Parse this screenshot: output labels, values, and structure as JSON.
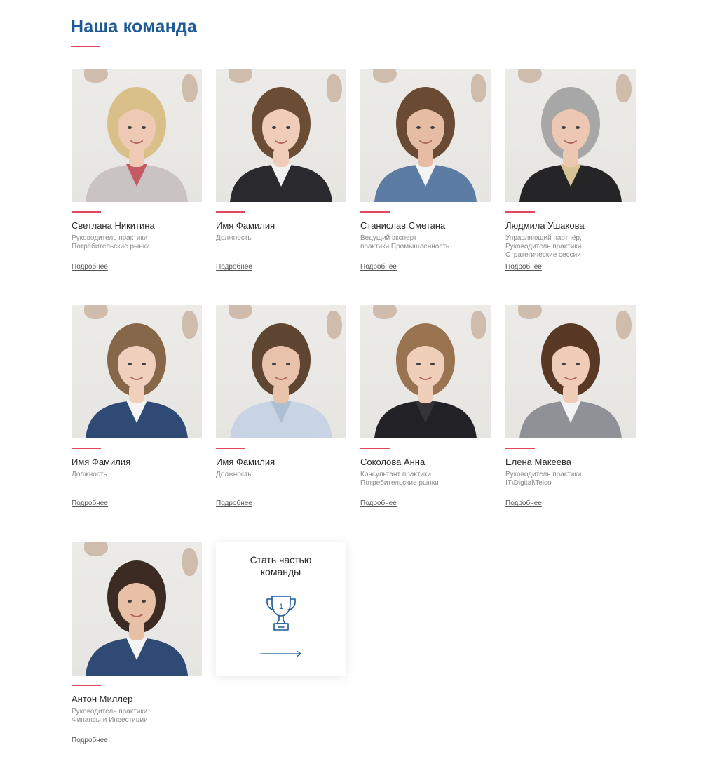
{
  "section": {
    "title": "Наша команда"
  },
  "team": [
    {
      "name": "Светлана Никитина",
      "role": "Руководитель практики\nПотребительские рынки",
      "more": "Подробнее",
      "hair": "#d9c089",
      "skin": "#eec9b3",
      "shirt": "#c9c3c4",
      "accent": "#c45a62"
    },
    {
      "name": "Имя Фамилия",
      "role": "Должность",
      "more": "Подробнее",
      "hair": "#6b4c35",
      "skin": "#efcdb9",
      "shirt": "#2a2a2e",
      "accent": "#f1f1f1"
    },
    {
      "name": "Станислав Сметана",
      "role": "Ведущий эксперт\nпрактики Промышленность",
      "more": "Подробнее",
      "hair": "#6a4a33",
      "skin": "#e6bda4",
      "shirt": "#5c7ca3",
      "accent": "#f3f3f3"
    },
    {
      "name": "Людмила Ушакова",
      "role": "Управляющий партнёр,\nРуководитель практики\nСтратегические сессии",
      "more": "Подробнее",
      "hair": "#a7a7a7",
      "skin": "#ecc8b3",
      "shirt": "#252527",
      "accent": "#d8c394"
    },
    {
      "name": "Имя Фамилия",
      "role": "Должность",
      "more": "Подробнее",
      "hair": "#86674a",
      "skin": "#f0d0bd",
      "shirt": "#2f4a74",
      "accent": "#f4f4f4"
    },
    {
      "name": "Имя Фамилия",
      "role": "Должность",
      "more": "Подробнее",
      "hair": "#5e4632",
      "skin": "#e8c2aa",
      "shirt": "#c8d4e3",
      "accent": "#aebfd4"
    },
    {
      "name": "Соколова Анна",
      "role": "Консультант практики\nПотребительские рынки",
      "more": "Подробнее",
      "hair": "#9a7450",
      "skin": "#efcfba",
      "shirt": "#222226",
      "accent": "#333338"
    },
    {
      "name": "Елена Макеева",
      "role": "Руководитель практики\nIT\\Digital\\Telco",
      "more": "Подробнее",
      "hair": "#5a3826",
      "skin": "#efccb8",
      "shirt": "#8f9196",
      "accent": "#f3f3f3"
    },
    {
      "name": "Антон Миллер",
      "role": "Руководитель практики\nФинансы и Инвестиции",
      "more": "Подробнее",
      "hair": "#3c2b22",
      "skin": "#e8c0a6",
      "shirt": "#2f4a74",
      "accent": "#f4f4f4"
    }
  ],
  "join": {
    "title": "Стать частью\nкоманды",
    "trophy_number": "1",
    "icon": "trophy-icon",
    "arrow_icon": "arrow-right-icon",
    "color": "#1f5a96"
  }
}
